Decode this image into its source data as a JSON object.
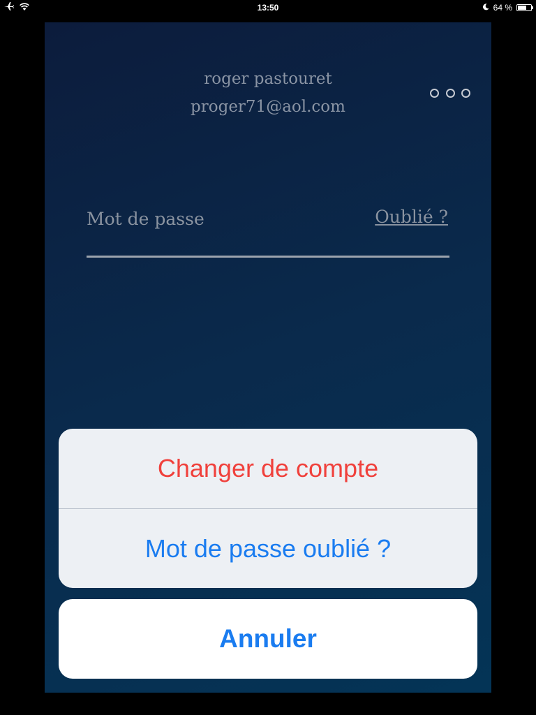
{
  "status_bar": {
    "time": "13:50",
    "battery_text": "64 %",
    "battery_level": 0.64,
    "icons": [
      "airplane-icon",
      "wifi-icon",
      "moon-icon",
      "battery-icon"
    ]
  },
  "account": {
    "name": "roger pastouret",
    "email": "proger71@aol.com",
    "more_icon": "more-options-icon"
  },
  "login": {
    "password_placeholder": "Mot de passe",
    "password_value": "",
    "forgot_label": "Oublié ?"
  },
  "action_sheet": {
    "items": [
      {
        "label": "Changer de compte",
        "color": "#f0413c"
      },
      {
        "label": "Mot de passe oublié ?",
        "color": "#1a7cf0"
      }
    ],
    "cancel_label": "Annuler",
    "cancel_color": "#1a7cf0"
  },
  "colors": {
    "background_start": "#0c1c3c",
    "background_end": "#043456",
    "sheet_background": "#edf0f4"
  }
}
